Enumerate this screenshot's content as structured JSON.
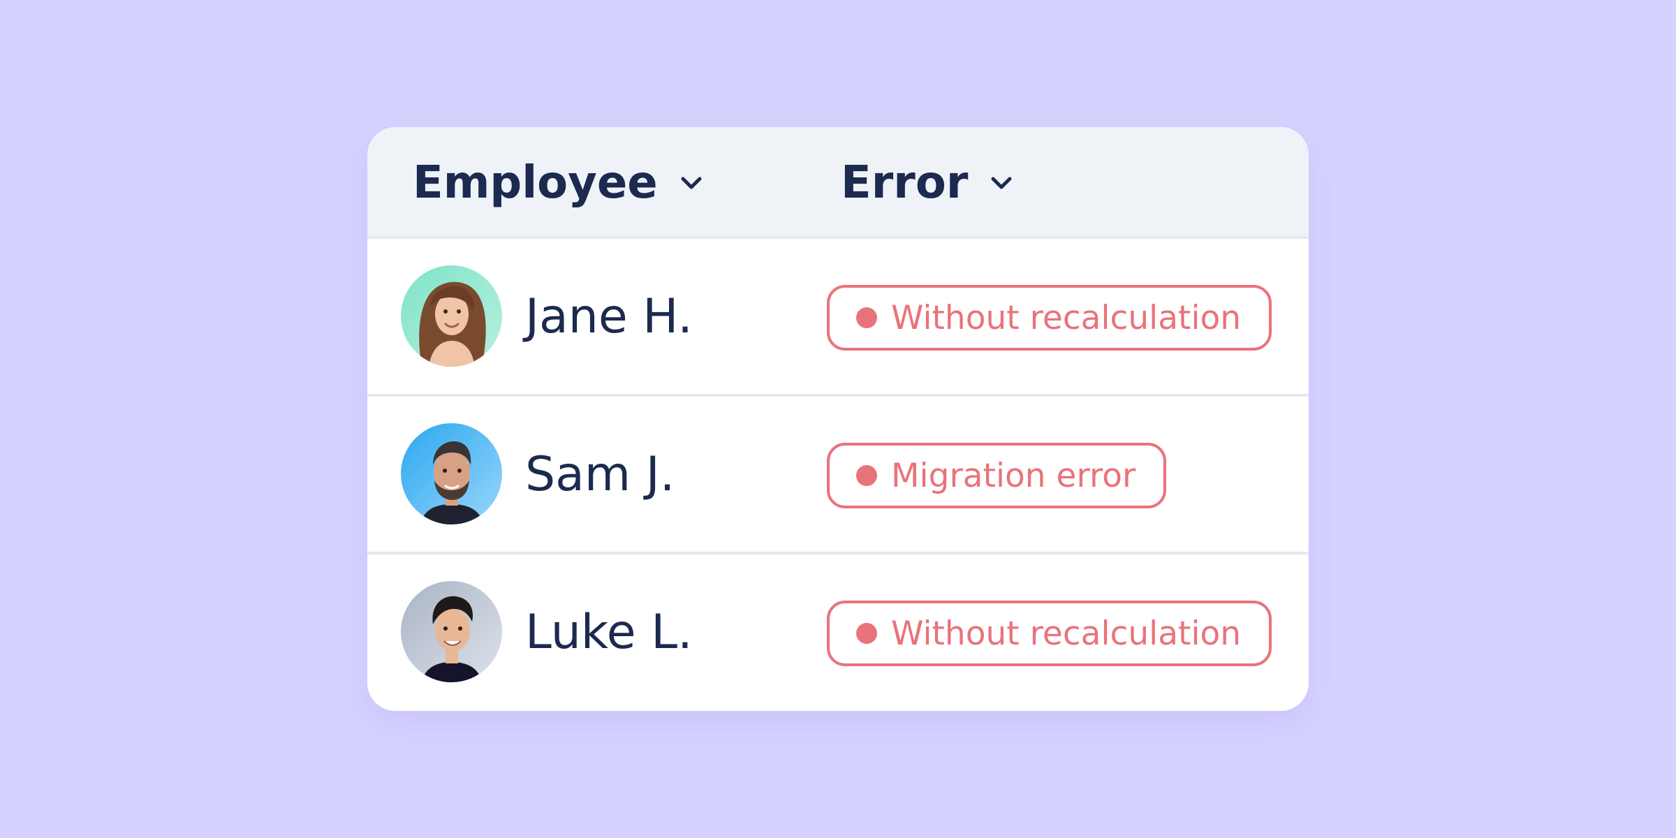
{
  "colors": {
    "background": "#D5D2FF",
    "card": "#FFFFFF",
    "header_bg": "#EFF3F8",
    "text": "#1B2A4E",
    "error": "#E9737A"
  },
  "table": {
    "columns": [
      {
        "label": "Employee",
        "icon": "chevron-down-icon"
      },
      {
        "label": "Error",
        "icon": "chevron-down-icon"
      }
    ],
    "rows": [
      {
        "name": "Jane H.",
        "avatar": "avatar-woman-curly-hair",
        "error": "Without recalculation"
      },
      {
        "name": "Sam J.",
        "avatar": "avatar-man-beard",
        "error": "Migration error"
      },
      {
        "name": "Luke L.",
        "avatar": "avatar-man-smiling",
        "error": "Without recalculation"
      }
    ]
  }
}
